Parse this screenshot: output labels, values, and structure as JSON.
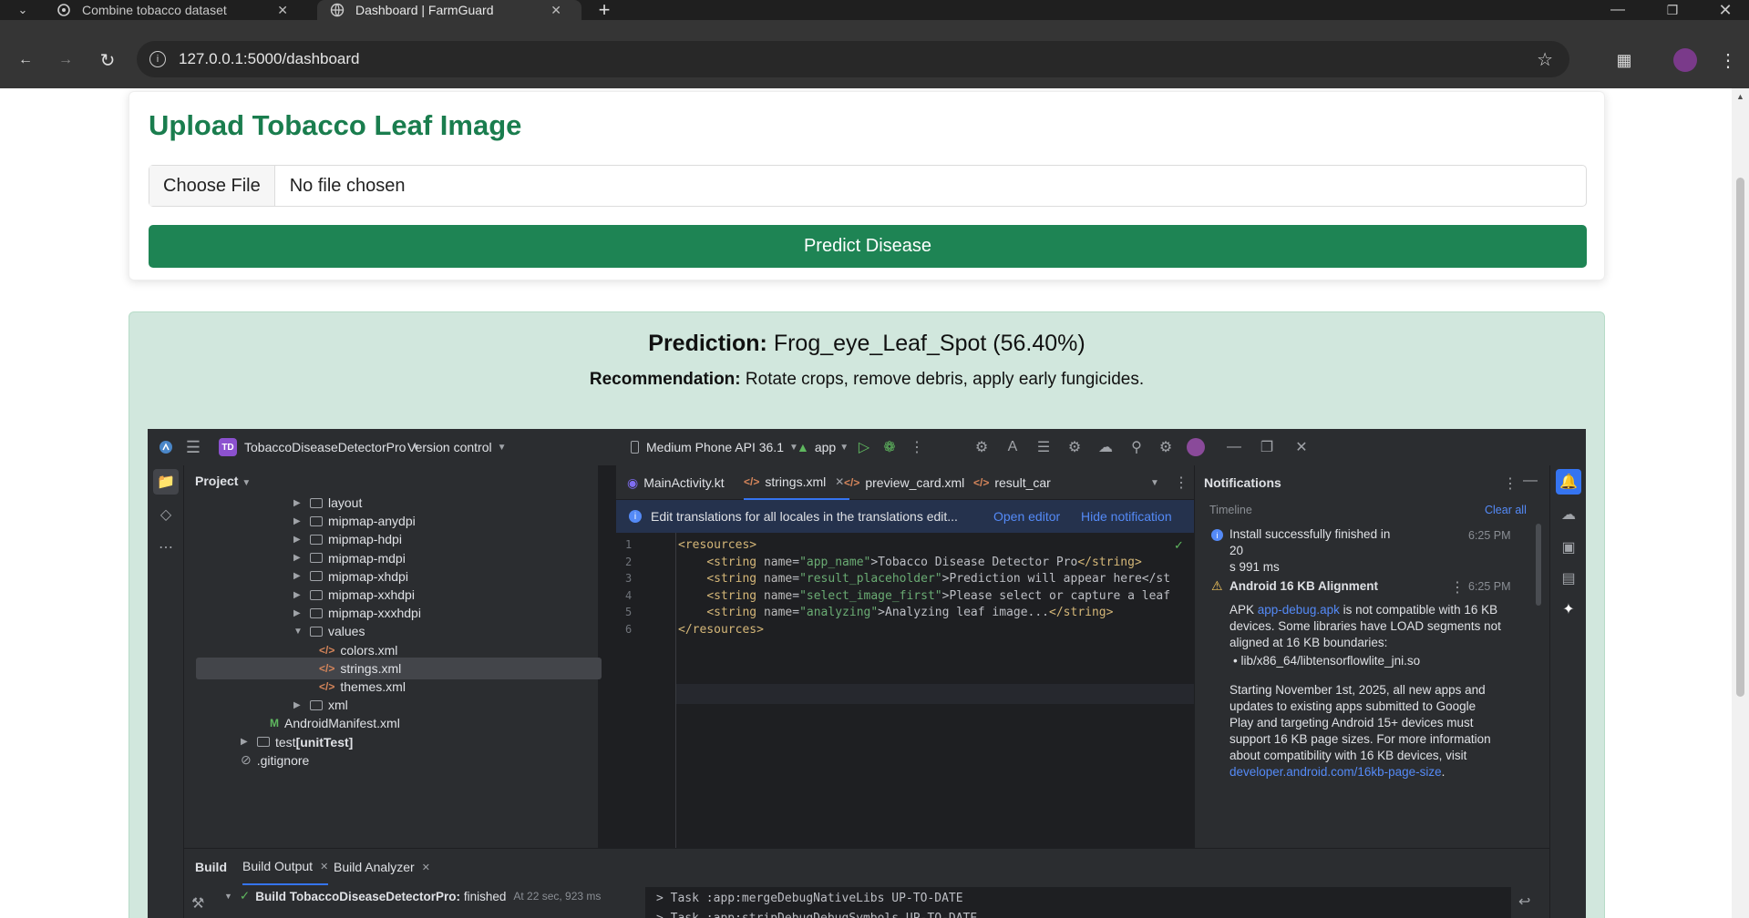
{
  "browser": {
    "tabs": [
      {
        "title": "Combine tobacco dataset",
        "icon": "chatgpt-icon"
      },
      {
        "title": "Dashboard | FarmGuard",
        "icon": "globe-icon"
      }
    ],
    "url": "127.0.0.1:5000/dashboard"
  },
  "upload": {
    "title": "Upload Tobacco Leaf Image",
    "choose_file": "Choose File",
    "no_file": "No file chosen",
    "predict_button": "Predict Disease"
  },
  "result": {
    "prediction_label": "Prediction:",
    "prediction_value": "Frog_eye_Leaf_Spot (56.40%)",
    "recommendation_label": "Recommendation:",
    "recommendation_value": "Rotate crops, remove debris, apply early fungicides."
  },
  "ide": {
    "project_badge": "TD",
    "project_name": "TobaccoDiseaseDetectorPro",
    "version_control": "Version control",
    "device": "Medium Phone API 36.1",
    "run_config": "app",
    "project_label": "Project",
    "tree": [
      {
        "label": "layout",
        "type": "folder"
      },
      {
        "label": "mipmap-anydpi",
        "type": "folder"
      },
      {
        "label": "mipmap-hdpi",
        "type": "folder"
      },
      {
        "label": "mipmap-mdpi",
        "type": "folder"
      },
      {
        "label": "mipmap-xhdpi",
        "type": "folder"
      },
      {
        "label": "mipmap-xxhdpi",
        "type": "folder"
      },
      {
        "label": "mipmap-xxxhdpi",
        "type": "folder"
      },
      {
        "label": "values",
        "type": "folder-open"
      },
      {
        "label": "colors.xml",
        "type": "xml"
      },
      {
        "label": "strings.xml",
        "type": "xml"
      },
      {
        "label": "themes.xml",
        "type": "xml"
      },
      {
        "label": "xml",
        "type": "folder"
      },
      {
        "label": "AndroidManifest.xml",
        "type": "manifest"
      },
      {
        "label": "test",
        "suffix": "[unitTest]",
        "type": "folder"
      },
      {
        "label": ".gitignore",
        "type": "ignore"
      }
    ],
    "editor_tabs": [
      "MainActivity.kt",
      "strings.xml",
      "preview_card.xml",
      "result_car"
    ],
    "banner": {
      "text": "Edit translations for all locales in the translations edit...",
      "open_editor": "Open editor",
      "hide": "Hide notification"
    },
    "code_lines": [
      {
        "n": "1",
        "text": "<resources>"
      },
      {
        "n": "2",
        "text": "    <string name=\"app_name\">Tobacco Disease Detector Pro</string>"
      },
      {
        "n": "3",
        "text": "    <string name=\"result_placeholder\">Prediction will appear here</st"
      },
      {
        "n": "4",
        "text": "    <string name=\"select_image_first\">Please select or capture a leaf"
      },
      {
        "n": "5",
        "text": "    <string name=\"analyzing\">Analyzing leaf image...</string>"
      },
      {
        "n": "6",
        "text": "</resources>"
      }
    ],
    "notifications": {
      "title": "Notifications",
      "timeline": "Timeline",
      "clear_all": "Clear all",
      "install_msg_1": "Install successfully finished in 20",
      "install_msg_2": "s 991 ms",
      "install_time": "6:25 PM",
      "alignment_title": "Android 16 KB Alignment",
      "alignment_time": "6:25 PM",
      "apk_prefix": "APK ",
      "apk_link": "app-debug.apk",
      "apk_suffix": " is not compatible with 16 KB devices. Some libraries have LOAD segments not aligned at 16 KB boundaries:",
      "lib": "• lib/x86_64/libtensorflowlite_jni.so",
      "starting": "Starting November 1st, 2025, all new apps and updates to existing apps submitted to Google Play and targeting Android 15+ devices must support 16 KB page sizes. For more information about compatibility with 16 KB devices, visit",
      "visit_link": "developer.android.com/16kb-page-size",
      "visit_suffix": "."
    },
    "bottom": {
      "build": "Build",
      "build_output": "Build Output",
      "build_analyzer": "Build Analyzer",
      "build_status": "Build TobaccoDiseaseDetectorPro:",
      "finished": "finished",
      "duration": "At 22 sec, 923 ms",
      "console": [
        "> Task :app:mergeDebugNativeLibs UP-TO-DATE",
        "> Task :app:stripDebugDebugSymbols UP-TO-DATE"
      ]
    }
  },
  "colors": {
    "brand_green": "#1a7d4e",
    "button_green": "#1e8454",
    "result_bg": "#d1e7dd"
  }
}
